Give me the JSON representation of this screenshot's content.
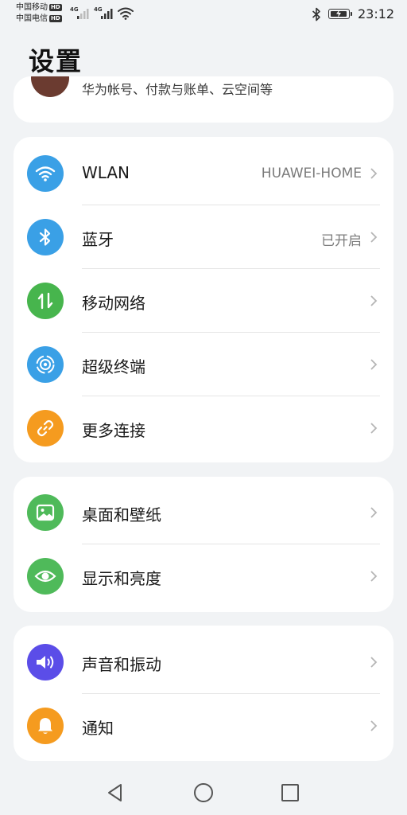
{
  "status_bar": {
    "carrier_1": "中国移动",
    "carrier_2": "中国电信",
    "hd_badge": "HD",
    "network_type": "4G",
    "time": "23:12"
  },
  "page": {
    "title": "设置"
  },
  "account": {
    "subtitle": "华为帐号、付款与账单、云空间等"
  },
  "connectivity": [
    {
      "label": "WLAN",
      "value": "HUAWEI-HOME",
      "icon": "wifi-icon",
      "color": "#3aa0e6"
    },
    {
      "label": "蓝牙",
      "value": "已开启",
      "icon": "bluetooth-icon",
      "color": "#3aa0e6"
    },
    {
      "label": "移动网络",
      "value": "",
      "icon": "mobile-data-icon",
      "color": "#47b54d"
    },
    {
      "label": "超级终端",
      "value": "",
      "icon": "super-device-icon",
      "color": "#3aa0e6"
    },
    {
      "label": "更多连接",
      "value": "",
      "icon": "link-icon",
      "color": "#f59b1f"
    }
  ],
  "display": [
    {
      "label": "桌面和壁纸",
      "icon": "wallpaper-icon",
      "color": "#4fba5a"
    },
    {
      "label": "显示和亮度",
      "icon": "eye-icon",
      "color": "#4fba5a"
    }
  ],
  "sound": [
    {
      "label": "声音和振动",
      "icon": "volume-icon",
      "color": "#5b4de8"
    },
    {
      "label": "通知",
      "icon": "bell-icon",
      "color": "#f59b1f"
    }
  ]
}
